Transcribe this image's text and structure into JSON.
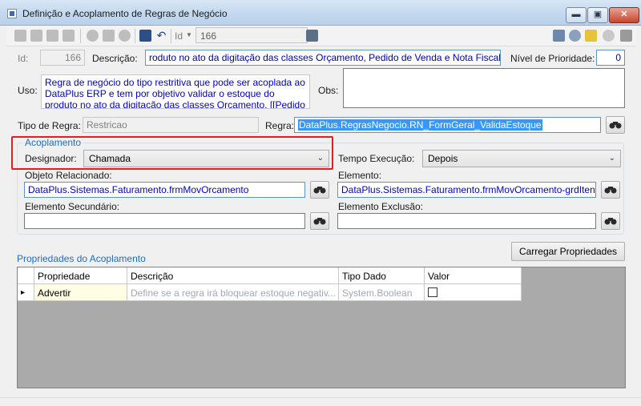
{
  "window": {
    "title": "Definição e Acoplamento de Regras de Negócio",
    "controls": {
      "minimize": "▬",
      "maximize": "▣",
      "close": "✕"
    }
  },
  "toolbar": {
    "id_label": "Id",
    "id_value": "166",
    "icons": [
      "first-icon",
      "previous-icon",
      "next-icon",
      "last-icon",
      "add-icon",
      "edit-icon",
      "delete-icon",
      "save-icon",
      "undo-icon",
      "export-icon",
      "settings-icon",
      "tools-icon",
      "notes-icon",
      "user-icon",
      "menu-icon"
    ]
  },
  "form": {
    "id_label": "Id:",
    "id_value": "166",
    "descricao_label": "Descrição:",
    "descricao_value": "roduto no ato da digitação das classes Orçamento, Pedido de Venda e Nota Fiscal",
    "prioridade_label": "Nível de Prioridade:",
    "prioridade_value": "0",
    "uso_label": "Uso:",
    "uso_value": "Regra de negócio do tipo restritiva que pode ser acoplada ao DataPlus ERP e tem por objetivo validar o estoque do produto no ato da digitação das classes Orçamento, [[Pedido de",
    "obs_label": "Obs:",
    "obs_value": "",
    "tipo_label": "Tipo de Regra:",
    "tipo_value": "Restricao",
    "regra_label": "Regra:",
    "regra_value": "DataPlus.RegrasNegocio.RN_FormGeral_ValidaEstoque"
  },
  "acoplamento": {
    "group_title": "Acoplamento",
    "designador_label": "Designador:",
    "designador_value": "Chamada",
    "tempo_label": "Tempo Execução:",
    "tempo_value": "Depois",
    "objeto_label": "Objeto Relacionado:",
    "objeto_value": "DataPlus.Sistemas.Faturamento.frmMovOrcamento",
    "elemento_label": "Elemento:",
    "elemento_value": "DataPlus.Sistemas.Faturamento.frmMovOrcamento-grdItens_",
    "elem_sec_label": "Elemento Secundário:",
    "elem_sec_value": "",
    "elem_exc_label": "Elemento Exclusão:",
    "elem_exc_value": ""
  },
  "propriedades": {
    "title": "Propriedades do Acoplamento",
    "load_button": "Carregar Propriedades",
    "columns": [
      "Propriedade",
      "Descrição",
      "Tipo Dado",
      "Valor"
    ],
    "rows": [
      {
        "indicator": "▸",
        "propriedade": "Advertir",
        "descricao": "Define se a regra irá bloquear estoque negativ...",
        "tipo": "System.Boolean",
        "valor": false
      }
    ]
  }
}
